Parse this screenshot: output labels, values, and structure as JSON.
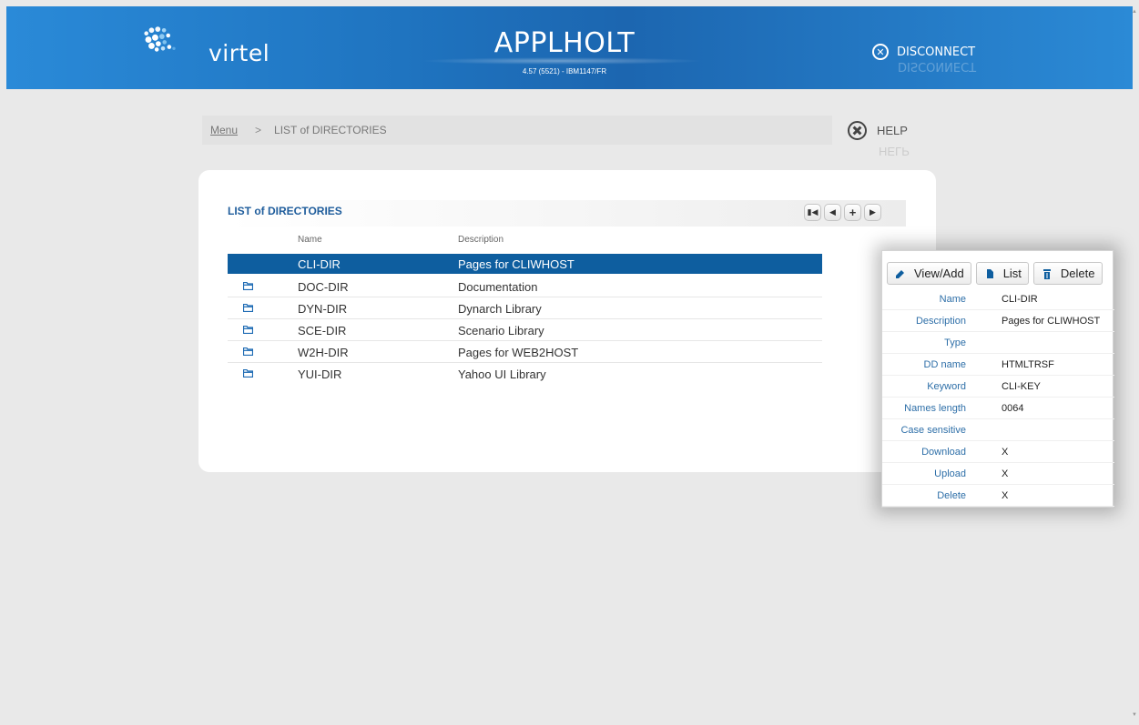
{
  "header": {
    "logo_text": "virtel",
    "app_title": "APPLHOLT",
    "version": "4.57 (5521) - IBM1147/FR",
    "disconnect_label": "DISCONNECT",
    "disconnect_icon": "close-circle-icon"
  },
  "breadcrumb": {
    "menu_label": "Menu",
    "separator": ">",
    "current": "LIST of DIRECTORIES"
  },
  "help": {
    "label": "HELP",
    "icon": "help-cross-icon"
  },
  "list": {
    "title": "LIST of DIRECTORIES",
    "pager": {
      "first_icon": "first-page-icon",
      "prev_icon": "previous-page-icon",
      "add_icon": "add-icon",
      "next_icon": "next-page-icon"
    },
    "columns": {
      "name": "Name",
      "description": "Description"
    },
    "rows": [
      {
        "name": "CLI-DIR",
        "description": "Pages for CLIWHOST",
        "selected": true
      },
      {
        "name": "DOC-DIR",
        "description": "Documentation",
        "selected": false
      },
      {
        "name": "DYN-DIR",
        "description": "Dynarch Library",
        "selected": false
      },
      {
        "name": "SCE-DIR",
        "description": "Scenario Library",
        "selected": false
      },
      {
        "name": "W2H-DIR",
        "description": "Pages for WEB2HOST",
        "selected": false
      },
      {
        "name": "YUI-DIR",
        "description": "Yahoo UI Library",
        "selected": false
      }
    ]
  },
  "detail": {
    "buttons": {
      "view_add": "View/Add",
      "list": "List",
      "delete": "Delete"
    },
    "fields": [
      {
        "label": "Name",
        "value": "CLI-DIR"
      },
      {
        "label": "Description",
        "value": "Pages for CLIWHOST"
      },
      {
        "label": "Type",
        "value": ""
      },
      {
        "label": "DD name",
        "value": "HTMLTRSF"
      },
      {
        "label": "Keyword",
        "value": "CLI-KEY"
      },
      {
        "label": "Names length",
        "value": "0064"
      },
      {
        "label": "Case sensitive",
        "value": ""
      },
      {
        "label": "Download",
        "value": "X"
      },
      {
        "label": "Upload",
        "value": "X"
      },
      {
        "label": "Delete",
        "value": "X"
      }
    ]
  },
  "colors": {
    "header_blue": "#1f74c0",
    "selected_row": "#0e5e9f",
    "title_blue": "#1f5d9c",
    "label_blue": "#2e6fa8"
  }
}
